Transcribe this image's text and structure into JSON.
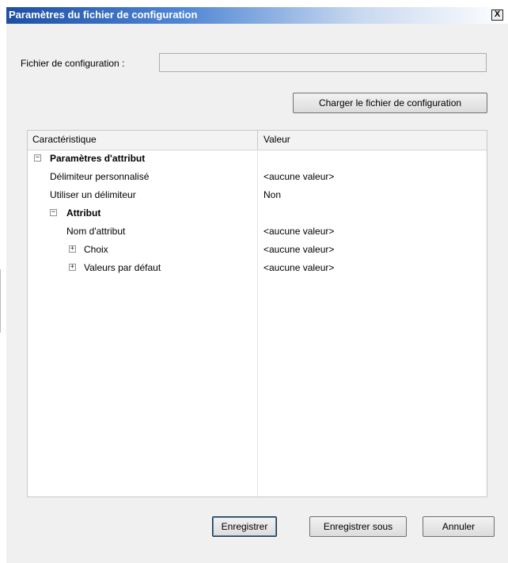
{
  "dialog": {
    "title": "Paramètres du fichier de configuration",
    "close_label": "X"
  },
  "config": {
    "label": "Fichier de configuration :",
    "value": "",
    "load_button": "Charger le fichier de configuration"
  },
  "grid": {
    "col_property": "Caractéristique",
    "col_value": "Valeur",
    "rows": [
      {
        "label": "Paramètres d'attribut",
        "value": "",
        "expander": "−"
      },
      {
        "label": "Délimiteur personnalisé",
        "value": "<aucune valeur>"
      },
      {
        "label": "Utiliser un délimiteur",
        "value": "Non"
      },
      {
        "label": "Attribut",
        "value": "",
        "expander": "−"
      },
      {
        "label": "Nom d'attribut",
        "value": "<aucune valeur>"
      },
      {
        "label": "Choix",
        "value": "<aucune valeur>",
        "expander": "+"
      },
      {
        "label": "Valeurs par défaut",
        "value": "<aucune valeur>",
        "expander": "+"
      }
    ]
  },
  "footer": {
    "save": "Enregistrer",
    "save_as": "Enregistrer sous",
    "cancel": "Annuler"
  }
}
